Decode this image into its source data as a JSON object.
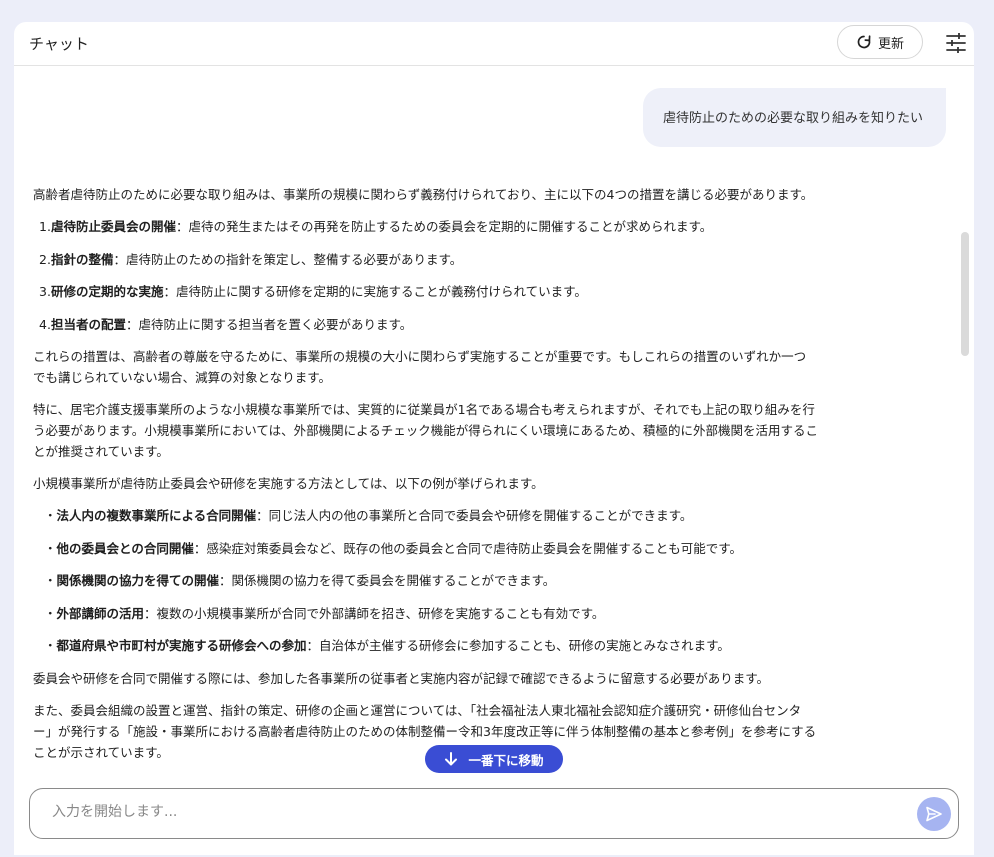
{
  "header": {
    "title": "チャット",
    "refresh_label": "更新"
  },
  "user_message": "虐待防止のための必要な取り組みを知りたい",
  "answer": {
    "intro": "高齢者虐待防止のために必要な取り組みは、事業所の規模に関わらず義務付けられており、主に以下の4つの措置を講じる必要があります。",
    "measures": [
      {
        "num": "1.",
        "title": "虐待防止委員会の開催",
        "text": "：虐待の発生またはその再発を防止するための委員会を定期的に開催することが求められます。"
      },
      {
        "num": "2.",
        "title": "指針の整備",
        "text": "：虐待防止のための指針を策定し、整備する必要があります。"
      },
      {
        "num": "3.",
        "title": "研修の定期的な実施",
        "text": "：虐待防止に関する研修を定期的に実施することが義務付けられています。"
      },
      {
        "num": "4.",
        "title": "担当者の配置",
        "text": "：虐待防止に関する担当者を置く必要があります。"
      }
    ],
    "para2": "これらの措置は、高齢者の尊厳を守るために、事業所の規模の大小に関わらず実施することが重要です。もしこれらの措置のいずれか一つでも講じられていない場合、減算の対象となります。",
    "para3": "特に、居宅介護支援事業所のような小規模な事業所では、実質的に従業員が1名である場合も考えられますが、それでも上記の取り組みを行う必要があります。小規模事業所においては、外部機関によるチェック機能が得られにくい環境にあるため、積極的に外部機関を活用することが推奨されています。",
    "para4": "小規模事業所が虐待防止委員会や研修を実施する方法としては、以下の例が挙げられます。",
    "methods": [
      {
        "title": "法人内の複数事業所による合同開催",
        "text": "：同じ法人内の他の事業所と合同で委員会や研修を開催することができます。"
      },
      {
        "title": "他の委員会との合同開催",
        "text": "：感染症対策委員会など、既存の他の委員会と合同で虐待防止委員会を開催することも可能です。"
      },
      {
        "title": "関係機関の協力を得ての開催",
        "text": "：関係機関の協力を得て委員会を開催することができます。"
      },
      {
        "title": "外部講師の活用",
        "text": "：複数の小規模事業所が合同で外部講師を招き、研修を実施することも有効です。"
      },
      {
        "title": "都道府県や市町村が実施する研修会への参加",
        "text": "：自治体が主催する研修会に参加することも、研修の実施とみなされます。"
      }
    ],
    "para5": "委員会や研修を合同で開催する際には、参加した各事業所の従事者と実施内容が記録で確認できるように留意する必要があります。",
    "para6": "また、委員会組織の設置と運営、指針の策定、研修の企画と運営については、「社会福祉法人東北福祉会認知症介護研究・研修仙台センター」が発行する「施設・事業所における高齢者虐待防止のための体制整備ー令和3年度改正等に伴う体制整備の基本と参考例」を参考にすることが示されています。"
  },
  "jump_label": "一番下に移動",
  "input": {
    "placeholder": "入力を開始します..."
  },
  "colors": {
    "background": "#eceef9",
    "accent": "#3a4dd4",
    "send_button": "#a6b4f1",
    "user_bubble": "#eef0f9"
  }
}
